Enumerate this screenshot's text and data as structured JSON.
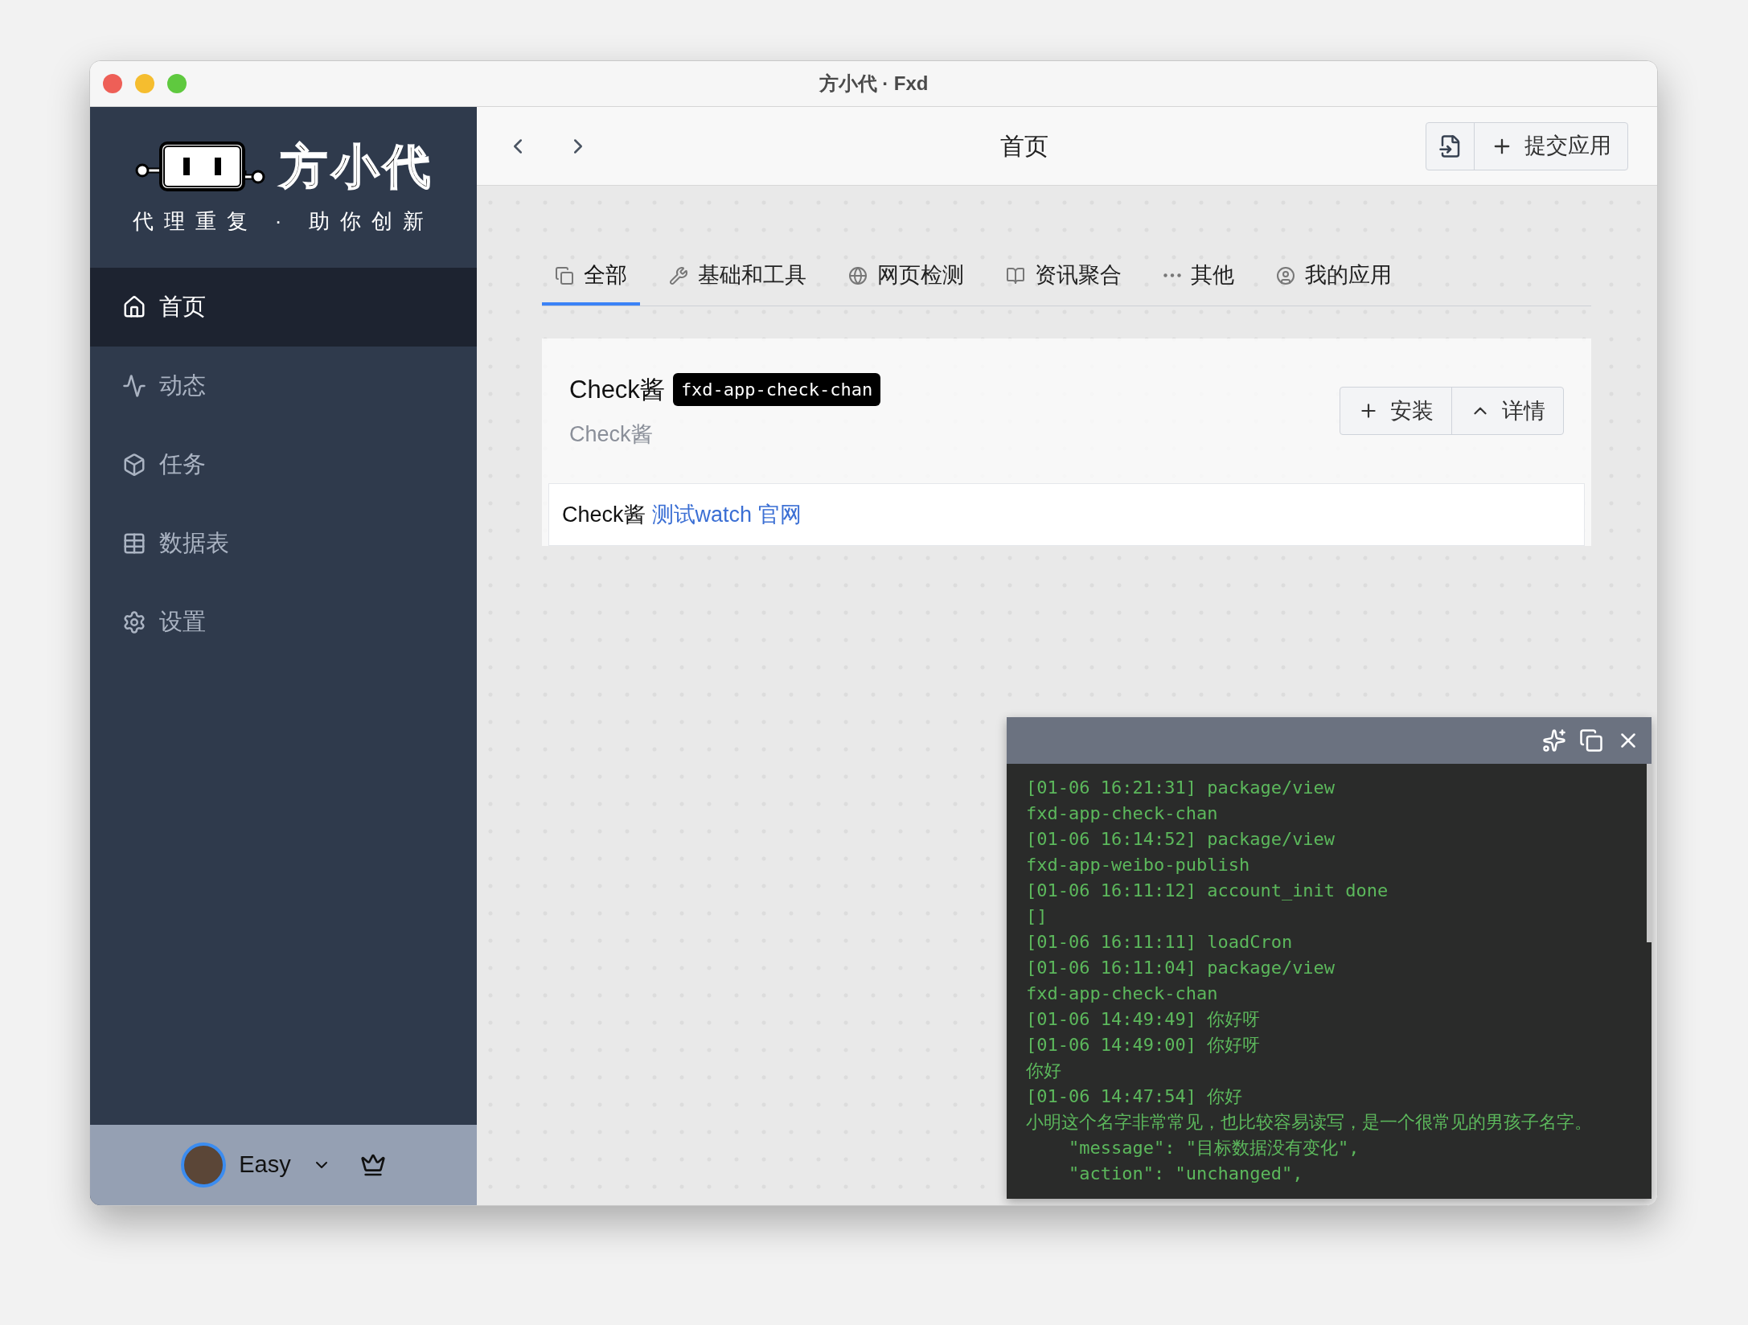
{
  "window": {
    "title": "方小代 · Fxd"
  },
  "sidebar": {
    "logo_text": "方小代",
    "slogan": "代理重复 · 助你创新",
    "items": [
      {
        "label": "首页",
        "selected": true
      },
      {
        "label": "动态",
        "selected": false
      },
      {
        "label": "任务",
        "selected": false
      },
      {
        "label": "数据表",
        "selected": false
      },
      {
        "label": "设置",
        "selected": false
      }
    ],
    "user": {
      "name": "Easy"
    }
  },
  "toolbar": {
    "title": "首页",
    "submit_button": "提交应用"
  },
  "tabs": [
    {
      "label": "全部",
      "selected": true
    },
    {
      "label": "基础和工具",
      "selected": false
    },
    {
      "label": "网页检测",
      "selected": false
    },
    {
      "label": "资讯聚合",
      "selected": false
    },
    {
      "label": "其他",
      "selected": false
    },
    {
      "label": "我的应用",
      "selected": false
    }
  ],
  "app_card": {
    "name": "Check酱",
    "package": "fxd-app-check-chan",
    "description": "Check酱",
    "buttons": [
      "安装",
      "详情"
    ],
    "footer_label": "Check酱",
    "links": [
      "测试watch",
      "官网"
    ]
  },
  "console": {
    "lines": [
      "[01-06 16:21:31] package/view",
      "fxd-app-check-chan",
      "[01-06 16:14:52] package/view",
      "fxd-app-weibo-publish",
      "[01-06 16:11:12] account_init done",
      "[]",
      "[01-06 16:11:11] loadCron",
      "[01-06 16:11:04] package/view",
      "fxd-app-check-chan",
      "[01-06 14:49:49] 你好呀",
      "[01-06 14:49:00] 你好呀",
      "你好",
      "[01-06 14:47:54] 你好",
      "小明这个名字非常常见，也比较容易读写，是一个很常见的男孩子名字。",
      "    \"message\": \"目标数据没有变化\",",
      "    \"action\": \"unchanged\","
    ]
  }
}
